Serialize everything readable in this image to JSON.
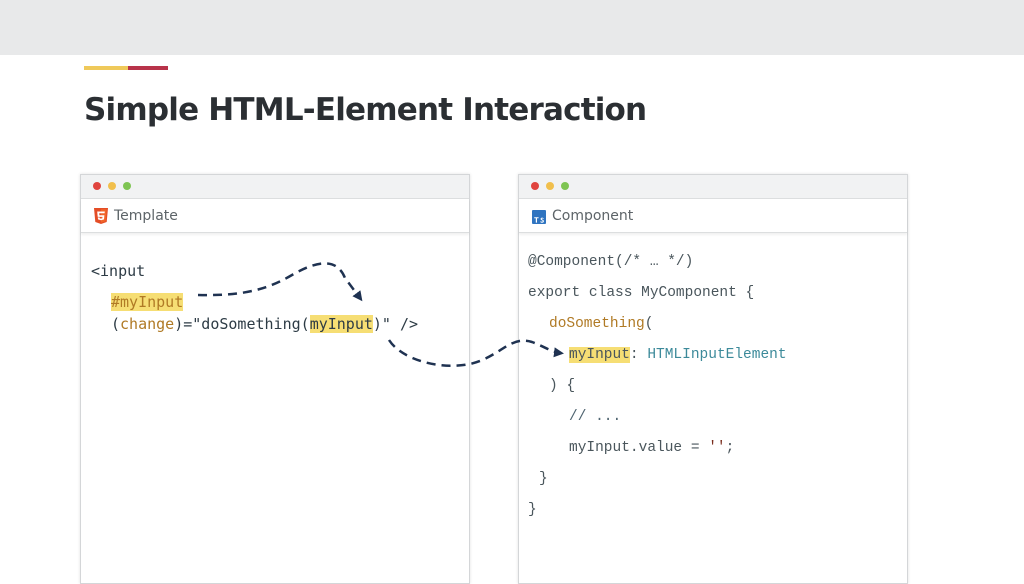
{
  "slide": {
    "title": "Simple HTML-Element Interaction",
    "colors": {
      "accent_yellow": "#efc95a",
      "accent_red": "#b8334a",
      "highlight": "#f6de74",
      "arrow": "#1f3251"
    }
  },
  "left_window": {
    "tab_icon": "html5-icon",
    "tab_label": "Template",
    "code": {
      "line1": "<input",
      "line2": "#myInput",
      "line3_pre": "(",
      "line3_event": "change",
      "line3_mid": ")=\"doSomething(",
      "line3_ref": "myInput",
      "line3_post": ")\" />"
    }
  },
  "right_window": {
    "tab_icon": "typescript-icon",
    "tab_label": "Component",
    "code": {
      "line1": "@Component(/* … */)",
      "line2": "export class MyComponent {",
      "line3_fn": "doSomething",
      "line3_paren": "(",
      "line4_param": "myInput",
      "line4_colon": ": ",
      "line4_type": "HTMLInputElement",
      "line5": ") {",
      "line6": "// ...",
      "line7_pre": "myInput.value = ",
      "line7_val": "''",
      "line7_post": ";",
      "line8": "}",
      "line9": "}"
    }
  }
}
